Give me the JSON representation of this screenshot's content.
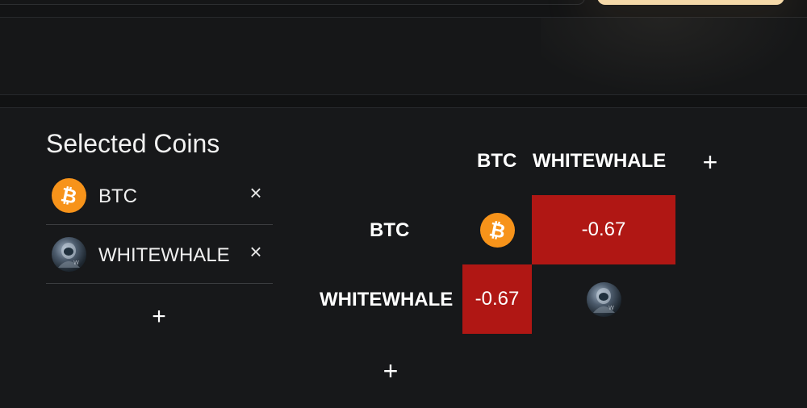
{
  "header": {
    "input_placeholder": "",
    "button_label": ""
  },
  "selected_coins": {
    "title": "Selected Coins",
    "items": [
      {
        "symbol": "BTC",
        "icon": "bitcoin-icon",
        "remove_glyph": "×"
      },
      {
        "symbol": "WHITEWHALE",
        "icon": "whitewhale-icon",
        "remove_glyph": "×"
      }
    ],
    "add_glyph": "+"
  },
  "correlation_matrix": {
    "columns": [
      "BTC",
      "WHITEWHALE"
    ],
    "rows": [
      "BTC",
      "WHITEWHALE"
    ],
    "values": [
      [
        null,
        "-0.67"
      ],
      [
        "-0.67",
        null
      ]
    ],
    "add_column_glyph": "+",
    "add_row_glyph": "+"
  },
  "colors": {
    "background": "#111213",
    "panel": "#17181a",
    "negative_cell": "#b01714",
    "btc_orange": "#f7931a",
    "accent_button": "#f5d9a8"
  }
}
